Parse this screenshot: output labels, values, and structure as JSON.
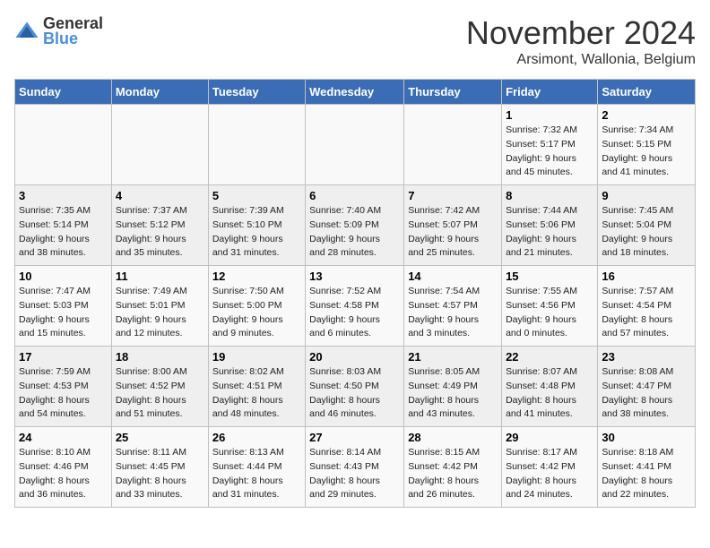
{
  "logo": {
    "text_general": "General",
    "text_blue": "Blue"
  },
  "title": "November 2024",
  "subtitle": "Arsimont, Wallonia, Belgium",
  "days_of_week": [
    "Sunday",
    "Monday",
    "Tuesday",
    "Wednesday",
    "Thursday",
    "Friday",
    "Saturday"
  ],
  "weeks": [
    [
      {
        "day": "",
        "info": ""
      },
      {
        "day": "",
        "info": ""
      },
      {
        "day": "",
        "info": ""
      },
      {
        "day": "",
        "info": ""
      },
      {
        "day": "",
        "info": ""
      },
      {
        "day": "1",
        "info": "Sunrise: 7:32 AM\nSunset: 5:17 PM\nDaylight: 9 hours\nand 45 minutes."
      },
      {
        "day": "2",
        "info": "Sunrise: 7:34 AM\nSunset: 5:15 PM\nDaylight: 9 hours\nand 41 minutes."
      }
    ],
    [
      {
        "day": "3",
        "info": "Sunrise: 7:35 AM\nSunset: 5:14 PM\nDaylight: 9 hours\nand 38 minutes."
      },
      {
        "day": "4",
        "info": "Sunrise: 7:37 AM\nSunset: 5:12 PM\nDaylight: 9 hours\nand 35 minutes."
      },
      {
        "day": "5",
        "info": "Sunrise: 7:39 AM\nSunset: 5:10 PM\nDaylight: 9 hours\nand 31 minutes."
      },
      {
        "day": "6",
        "info": "Sunrise: 7:40 AM\nSunset: 5:09 PM\nDaylight: 9 hours\nand 28 minutes."
      },
      {
        "day": "7",
        "info": "Sunrise: 7:42 AM\nSunset: 5:07 PM\nDaylight: 9 hours\nand 25 minutes."
      },
      {
        "day": "8",
        "info": "Sunrise: 7:44 AM\nSunset: 5:06 PM\nDaylight: 9 hours\nand 21 minutes."
      },
      {
        "day": "9",
        "info": "Sunrise: 7:45 AM\nSunset: 5:04 PM\nDaylight: 9 hours\nand 18 minutes."
      }
    ],
    [
      {
        "day": "10",
        "info": "Sunrise: 7:47 AM\nSunset: 5:03 PM\nDaylight: 9 hours\nand 15 minutes."
      },
      {
        "day": "11",
        "info": "Sunrise: 7:49 AM\nSunset: 5:01 PM\nDaylight: 9 hours\nand 12 minutes."
      },
      {
        "day": "12",
        "info": "Sunrise: 7:50 AM\nSunset: 5:00 PM\nDaylight: 9 hours\nand 9 minutes."
      },
      {
        "day": "13",
        "info": "Sunrise: 7:52 AM\nSunset: 4:58 PM\nDaylight: 9 hours\nand 6 minutes."
      },
      {
        "day": "14",
        "info": "Sunrise: 7:54 AM\nSunset: 4:57 PM\nDaylight: 9 hours\nand 3 minutes."
      },
      {
        "day": "15",
        "info": "Sunrise: 7:55 AM\nSunset: 4:56 PM\nDaylight: 9 hours\nand 0 minutes."
      },
      {
        "day": "16",
        "info": "Sunrise: 7:57 AM\nSunset: 4:54 PM\nDaylight: 8 hours\nand 57 minutes."
      }
    ],
    [
      {
        "day": "17",
        "info": "Sunrise: 7:59 AM\nSunset: 4:53 PM\nDaylight: 8 hours\nand 54 minutes."
      },
      {
        "day": "18",
        "info": "Sunrise: 8:00 AM\nSunset: 4:52 PM\nDaylight: 8 hours\nand 51 minutes."
      },
      {
        "day": "19",
        "info": "Sunrise: 8:02 AM\nSunset: 4:51 PM\nDaylight: 8 hours\nand 48 minutes."
      },
      {
        "day": "20",
        "info": "Sunrise: 8:03 AM\nSunset: 4:50 PM\nDaylight: 8 hours\nand 46 minutes."
      },
      {
        "day": "21",
        "info": "Sunrise: 8:05 AM\nSunset: 4:49 PM\nDaylight: 8 hours\nand 43 minutes."
      },
      {
        "day": "22",
        "info": "Sunrise: 8:07 AM\nSunset: 4:48 PM\nDaylight: 8 hours\nand 41 minutes."
      },
      {
        "day": "23",
        "info": "Sunrise: 8:08 AM\nSunset: 4:47 PM\nDaylight: 8 hours\nand 38 minutes."
      }
    ],
    [
      {
        "day": "24",
        "info": "Sunrise: 8:10 AM\nSunset: 4:46 PM\nDaylight: 8 hours\nand 36 minutes."
      },
      {
        "day": "25",
        "info": "Sunrise: 8:11 AM\nSunset: 4:45 PM\nDaylight: 8 hours\nand 33 minutes."
      },
      {
        "day": "26",
        "info": "Sunrise: 8:13 AM\nSunset: 4:44 PM\nDaylight: 8 hours\nand 31 minutes."
      },
      {
        "day": "27",
        "info": "Sunrise: 8:14 AM\nSunset: 4:43 PM\nDaylight: 8 hours\nand 29 minutes."
      },
      {
        "day": "28",
        "info": "Sunrise: 8:15 AM\nSunset: 4:42 PM\nDaylight: 8 hours\nand 26 minutes."
      },
      {
        "day": "29",
        "info": "Sunrise: 8:17 AM\nSunset: 4:42 PM\nDaylight: 8 hours\nand 24 minutes."
      },
      {
        "day": "30",
        "info": "Sunrise: 8:18 AM\nSunset: 4:41 PM\nDaylight: 8 hours\nand 22 minutes."
      }
    ]
  ]
}
